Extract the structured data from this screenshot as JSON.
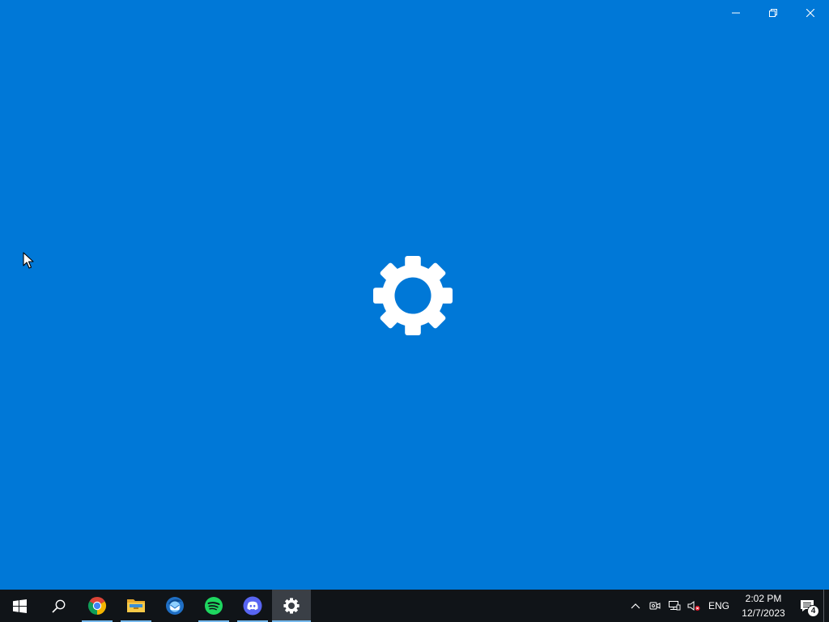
{
  "window": {
    "background": "#0078d7",
    "caption_buttons": [
      {
        "name": "minimize-button",
        "icon": "minimize-icon"
      },
      {
        "name": "restore-button",
        "icon": "restore-icon"
      },
      {
        "name": "close-button",
        "icon": "close-icon"
      }
    ],
    "splash_icon": "gear-icon"
  },
  "taskbar": {
    "background": "#101418",
    "indicator_color": "#76b9ed",
    "buttons": [
      {
        "name": "start-button",
        "icon": "windows-logo-icon",
        "running": false
      },
      {
        "name": "search-button",
        "icon": "search-icon",
        "running": false
      },
      {
        "name": "chrome-taskbar-button",
        "icon": "chrome-icon",
        "running": true
      },
      {
        "name": "file-explorer-taskbar-button",
        "icon": "folder-icon",
        "running": true
      },
      {
        "name": "thunderbird-taskbar-button",
        "icon": "thunderbird-icon",
        "running": false
      },
      {
        "name": "spotify-taskbar-button",
        "icon": "spotify-icon",
        "running": true
      },
      {
        "name": "discord-taskbar-button",
        "icon": "discord-icon",
        "running": true
      },
      {
        "name": "settings-taskbar-button",
        "icon": "gear-icon",
        "running": true,
        "active": true
      }
    ]
  },
  "tray": {
    "icons": [
      "chevron-up-icon",
      "meet-now-icon",
      "network-icon",
      "volume-muted-icon"
    ],
    "language": "ENG",
    "time": "2:02 PM",
    "date": "12/7/2023",
    "notification_count": "4"
  }
}
